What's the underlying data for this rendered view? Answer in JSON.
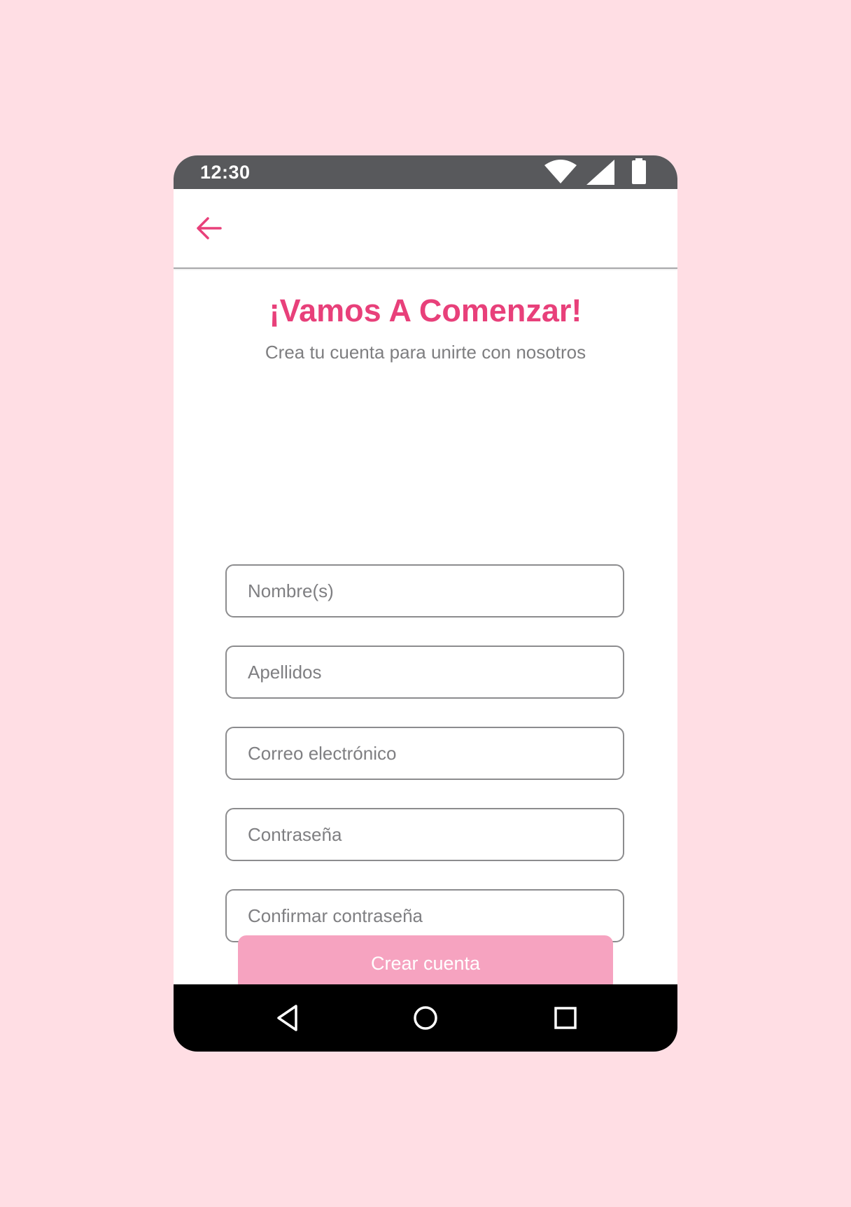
{
  "status_bar": {
    "time": "12:30",
    "icons": [
      "wifi-icon",
      "signal-icon",
      "battery-icon"
    ]
  },
  "app_bar": {
    "back_icon": "arrow-left-icon"
  },
  "header": {
    "title": "¡Vamos A Comenzar!",
    "subtitle": "Crea tu cuenta para unirte con nosotros"
  },
  "form": {
    "fields": [
      {
        "placeholder": "Nombre(s)",
        "value": ""
      },
      {
        "placeholder": "Apellidos",
        "value": ""
      },
      {
        "placeholder": "Correo electrónico",
        "value": ""
      },
      {
        "placeholder": "Contraseña",
        "value": ""
      },
      {
        "placeholder": "Confirmar contraseña",
        "value": ""
      }
    ],
    "submit_label": "Crear cuenta"
  },
  "nav_bar": {
    "icons": [
      "back-triangle-icon",
      "home-circle-icon",
      "recents-square-icon"
    ]
  },
  "colors": {
    "background": "#FFDEE4",
    "accent": "#E8407A",
    "button": "#F6A3C0",
    "status_bar": "#58595C",
    "nav_bar": "#000000"
  }
}
